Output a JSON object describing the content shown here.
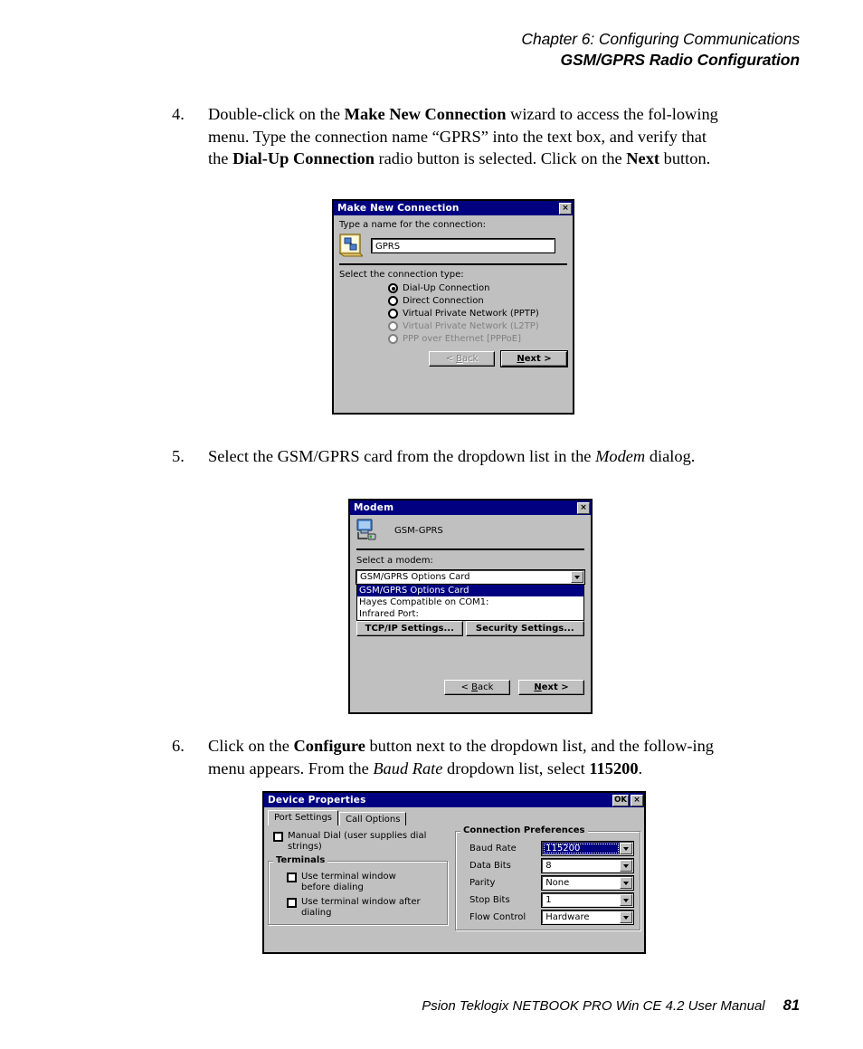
{
  "header": {
    "chapter": "Chapter 6:  Configuring Communications",
    "section": "GSM/GPRS Radio Configuration"
  },
  "steps": {
    "step4": {
      "number": "4."
    },
    "step5": {
      "number": "5."
    },
    "step6": {
      "number": "6."
    }
  },
  "dialog_make_new_connection": {
    "title": "Make New Connection",
    "close_label": "×",
    "name_prompt": "Type a name for the connection:",
    "name_value": "GPRS",
    "type_prompt": "Select the connection type:",
    "options": [
      {
        "label": "Dial-Up Connection",
        "selected": true,
        "disabled": false
      },
      {
        "label": "Direct Connection",
        "selected": false,
        "disabled": false
      },
      {
        "label": "Virtual Private Network (PPTP)",
        "selected": false,
        "disabled": false
      },
      {
        "label": "Virtual Private Network (L2TP)",
        "selected": false,
        "disabled": true
      },
      {
        "label": "PPP over Ethernet [PPPoE]",
        "selected": false,
        "disabled": true
      }
    ],
    "back_label": "< Back",
    "next_label": "Next >"
  },
  "dialog_modem": {
    "title": "Modem",
    "close_label": "×",
    "connection_name": "GSM-GPRS",
    "select_prompt": "Select a modem:",
    "combo_value": "GSM/GPRS Options Card",
    "options": [
      "GSM/GPRS Options Card",
      "Hayes Compatible on COM1:",
      "Infrared Port:"
    ],
    "selected_option_index": 0,
    "tcpip_label": "TCP/IP Settings...",
    "security_label": "Security Settings...",
    "back_label": "< Back",
    "next_label": "Next >"
  },
  "dialog_device_properties": {
    "title": "Device Properties",
    "ok_label": "OK",
    "close_label": "×",
    "tabs": [
      {
        "label": "Port Settings",
        "active": true
      },
      {
        "label": "Call Options",
        "active": false
      }
    ],
    "manual_dial_label": "Manual Dial (user supplies dial strings)",
    "manual_dial_checked": false,
    "terminals_group_title": "Terminals",
    "terminal_options": [
      {
        "label": "Use terminal window before dialing",
        "checked": false
      },
      {
        "label": "Use terminal window after dialing",
        "checked": false
      }
    ],
    "preferences_group_title": "Connection Preferences",
    "preferences": [
      {
        "label": "Baud Rate",
        "value": "115200",
        "highlighted": true
      },
      {
        "label": "Data Bits",
        "value": "8",
        "highlighted": false
      },
      {
        "label": "Parity",
        "value": "None",
        "highlighted": false
      },
      {
        "label": "Stop Bits",
        "value": "1",
        "highlighted": false
      },
      {
        "label": "Flow Control",
        "value": "Hardware",
        "highlighted": false
      }
    ]
  },
  "footer": {
    "manual": "Psion Teklogix NETBOOK PRO Win CE 4.2 User Manual",
    "page": "81"
  },
  "colors": {
    "titlebar": "#000080",
    "dialog_face": "#c0c0c0",
    "highlight": "#000080",
    "disabled_text": "#808080"
  }
}
